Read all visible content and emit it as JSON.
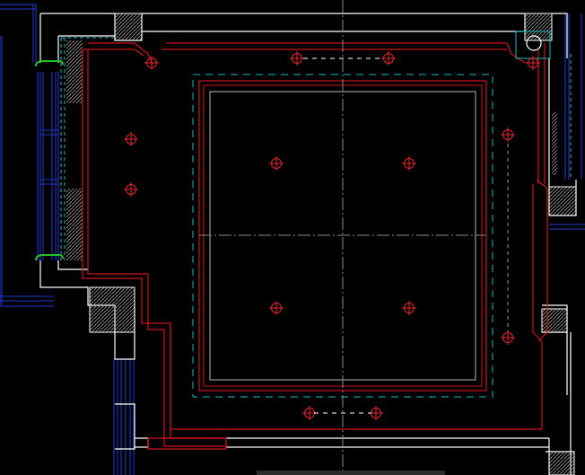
{
  "app": {
    "name": ""
  },
  "colors": {
    "background": "#000000",
    "wall": "#ffffff",
    "ceiling_red": "#d0121b",
    "light_fixture": "#e8232a",
    "dashed_cyan": "#18b8c8",
    "window_blue": "#2438d8",
    "center_axis": "#8c8c8c",
    "hatch": "#9a9a9a",
    "window_hinge_green": "#22c022",
    "status_strip": "#2b2b2b"
  },
  "drawing": {
    "view": "reflected-ceiling-plan",
    "light_fixture_icon": "crosshair-circle",
    "ceiling_light_count": 14,
    "window_count": 2,
    "column_count": 5
  },
  "status_bar": {
    "text": ""
  }
}
